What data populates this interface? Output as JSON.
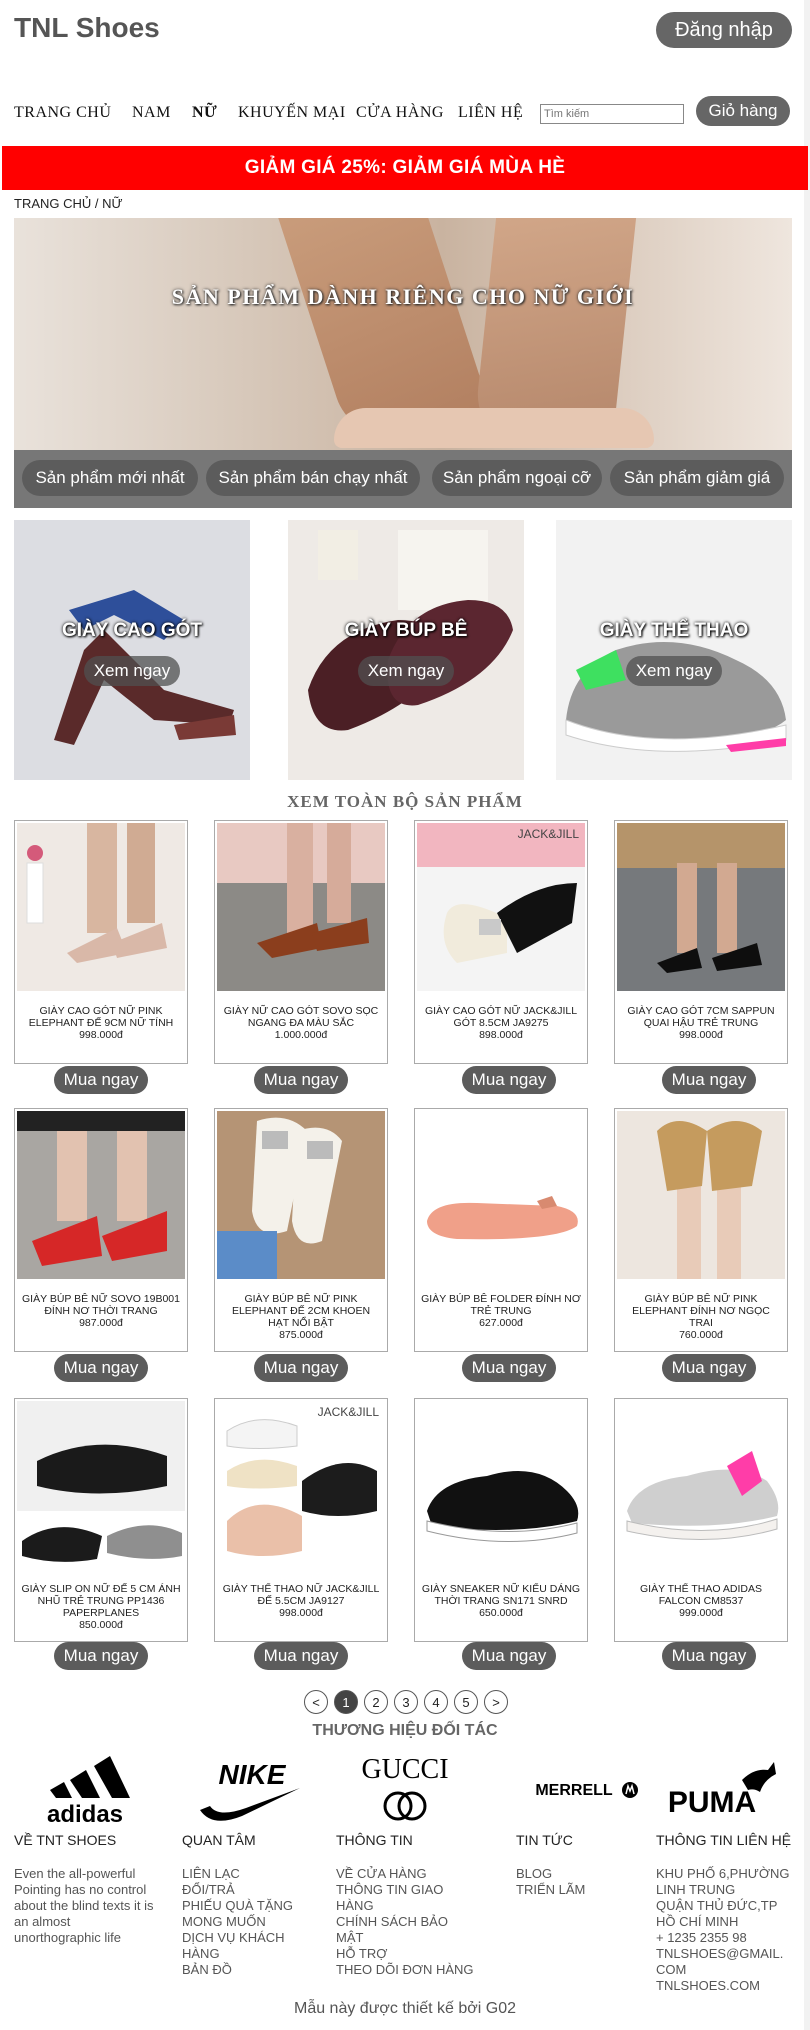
{
  "header": {
    "logo": "TNL Shoes",
    "login_label": "Đăng nhập"
  },
  "nav": {
    "items": [
      {
        "label": "TRANG CHỦ",
        "active": false
      },
      {
        "label": "NAM",
        "active": false
      },
      {
        "label": "NỮ",
        "active": true
      },
      {
        "label": "KHUYẾN MẠI",
        "active": false
      },
      {
        "label": "CỬA HÀNG",
        "active": false
      },
      {
        "label": "LIÊN HỆ",
        "active": false
      }
    ],
    "search_placeholder": "Tìm kiếm",
    "cart_label": "Giỏ hàng"
  },
  "promo": {
    "text": "GIẢM GIÁ 25%: GIẢM GIÁ MÙA HÈ",
    "color": "#ff0000"
  },
  "breadcrumb": "TRANG CHỦ / NỮ",
  "hero": {
    "title": "SẢN PHẨM DÀNH RIÊNG CHO NỮ GIỚI",
    "tabs": [
      "Sản phẩm mới nhất",
      "Sản phẩm bán chạy nhất",
      "Sản phẩm ngoại cỡ",
      "Sản phẩm giảm giá"
    ]
  },
  "categories": [
    {
      "title": "GIÀY CAO GÓT",
      "button": "Xem ngay"
    },
    {
      "title": "GIÀY BÚP BÊ",
      "button": "Xem ngay"
    },
    {
      "title": "GIÀY THỂ THAO",
      "button": "Xem ngay"
    }
  ],
  "products_title": "XEM TOÀN BỘ SẢN PHẨM",
  "buy_label": "Mua ngay",
  "products": [
    {
      "name": "GIÀY CAO GÓT NỮ PINK ELEPHANT ĐẾ 9CM NỮ TÍNH",
      "price": "998.000đ"
    },
    {
      "name": "GIÀY NỮ CAO GÓT SOVO SỌC NGANG ĐA MÀU SẮC",
      "price": "1.000.000đ"
    },
    {
      "name": "GIÀY CAO GÓT NỮ JACK&JILL GÓT 8.5CM JA9275",
      "price": "898.000đ"
    },
    {
      "name": "GIÀY CAO GÓT 7CM SAPPUN QUAI HẬU TRẺ TRUNG",
      "price": "998.000đ"
    },
    {
      "name": "GIÀY BÚP BÊ NỮ SOVO 19B001 ĐÍNH NƠ THỜI TRANG",
      "price": "987.000đ"
    },
    {
      "name": "GIÀY BÚP BÊ NỮ PINK ELEPHANT ĐẾ 2CM KHOEN HẠT NỔI BẬT",
      "price": "875.000đ"
    },
    {
      "name": "GIÀY BÚP BÊ FOLDER ĐÍNH NƠ TRẺ TRUNG",
      "price": "627.000đ"
    },
    {
      "name": "GIÀY BÚP BÊ NỮ PINK ELEPHANT ĐÍNH NƠ NGỌC TRAI",
      "price": "760.000đ"
    },
    {
      "name": "GIÀY SLIP ON NỮ ĐẾ 5 CM ÁNH NHŨ TRẺ TRUNG PP1436 PAPERPLANES",
      "price": "850.000đ"
    },
    {
      "name": "GIÀY THỂ THAO NỮ JACK&JILL ĐẾ 5.5CM JA9127",
      "price": "998.000đ"
    },
    {
      "name": "GIÀY SNEAKER NỮ KIỂU DÁNG THỜI TRANG SN171 SNRD",
      "price": "650.000đ"
    },
    {
      "name": "GIÀY THỂ THAO ADIDAS FALCON CM8537",
      "price": "999.000đ"
    }
  ],
  "product_badges": {
    "p3": "JACK&JILL",
    "p10": "JACK&JILL"
  },
  "pagination": {
    "prev": "<",
    "pages": [
      "1",
      "2",
      "3",
      "4",
      "5"
    ],
    "current": "1",
    "next": ">"
  },
  "partners": {
    "title": "THƯƠNG HIỆU ĐỐI TÁC",
    "brands": [
      "adidas",
      "NIKE",
      "GUCCI",
      "MERRELL",
      "PUMA"
    ]
  },
  "footer": {
    "about": {
      "heading": "VỀ TNT SHOES",
      "text": "Even the all-powerful Pointing has no control about the blind texts it is an almost unorthographic life"
    },
    "care": {
      "heading": "QUAN TÂM",
      "links": [
        "LIÊN LẠC",
        "ĐỔI/TRẢ",
        "PHIẾU QUÀ TẶNG",
        "MONG MUỐN",
        "DỊCH VỤ KHÁCH HÀNG",
        "BẢN ĐỒ"
      ]
    },
    "info": {
      "heading": "THÔNG TIN",
      "links": [
        "VỀ CỬA HÀNG",
        "THÔNG TIN GIAO HÀNG",
        "CHÍNH SÁCH BẢO MẬT",
        "HỖ TRỢ",
        "THEO DÕI ĐƠN HÀNG"
      ]
    },
    "news": {
      "heading": "TIN TỨC",
      "links": [
        "BLOG",
        "TRIỂN LÃM"
      ]
    },
    "contact": {
      "heading": "THÔNG TIN LIÊN HỆ",
      "lines": [
        "KHU PHỐ 6,PHƯỜNG LINH TRUNG",
        "QUẬN THỦ ĐỨC,TP HỒ CHÍ MINH",
        "+ 1235 2355 98",
        "TNLSHOES@GMAIL.COM",
        "TNLSHOES.COM"
      ]
    }
  },
  "credit": "Mẫu này được thiết kế bởi G02"
}
